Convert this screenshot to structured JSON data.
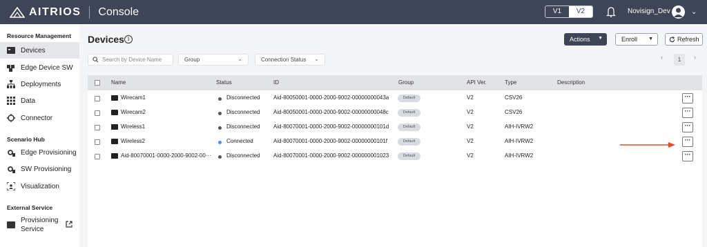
{
  "header": {
    "brand": "AITRIOS",
    "app": "Console",
    "versions": [
      "V1",
      "V2"
    ],
    "user": "Novisign_Dev"
  },
  "sidebar": {
    "sections": [
      {
        "title": "Resource Management",
        "items": [
          {
            "label": "Devices",
            "icon": "devices-icon"
          },
          {
            "label": "Edge Device SW",
            "icon": "puzzle-icon"
          },
          {
            "label": "Deployments",
            "icon": "hierarchy-icon"
          },
          {
            "label": "Data",
            "icon": "grid-icon"
          },
          {
            "label": "Connector",
            "icon": "connector-icon"
          }
        ]
      },
      {
        "title": "Scenario Hub",
        "items": [
          {
            "label": "Edge Provisioning",
            "icon": "gear-icon"
          },
          {
            "label": "SW Provisioning",
            "icon": "gear-icon"
          },
          {
            "label": "Visualization",
            "icon": "visualization-icon"
          }
        ]
      },
      {
        "title": "External Service",
        "items": [
          {
            "label": "Provisioning Service",
            "label_line1": "Provisioning",
            "label_line2": "Service",
            "icon": "service-icon"
          }
        ]
      }
    ]
  },
  "main": {
    "title": "Devices",
    "actions_label": "Actions",
    "enroll_label": "Enroll",
    "refresh_label": "Refresh",
    "search_placeholder": "Search by Device Name",
    "group_filter": "Group",
    "status_filter": "Connection Status",
    "page": "1"
  },
  "table": {
    "columns": [
      "Name",
      "Status",
      "ID",
      "Group",
      "API Ver.",
      "Type",
      "Description"
    ],
    "rows": [
      {
        "name": "Wirecam1",
        "status": "Disconnected",
        "id": "Aid-80050001-0000-2000-9002-00000000043a",
        "group": "Default",
        "api": "V2",
        "type": "CSV26",
        "description": ""
      },
      {
        "name": "Wirecam2",
        "status": "Disconnected",
        "id": "Aid-80050001-0000-2000-9002-00000000048c",
        "group": "Default",
        "api": "V2",
        "type": "CSV26",
        "description": ""
      },
      {
        "name": "Wireless1",
        "status": "Disconnected",
        "id": "Aid-80070001-0000-2000-9002-00000000101d",
        "group": "Default",
        "api": "V2",
        "type": "AIH-IVRW2",
        "description": ""
      },
      {
        "name": "Wireless2",
        "status": "Connected",
        "id": "Aid-80070001-0000-2000-9002-00000000101f",
        "group": "Default",
        "api": "V2",
        "type": "AIH-IVRW2",
        "description": ""
      },
      {
        "name": "Aid-80070001-0000-2000-9002-00···",
        "status": "Disconnected",
        "id": "Aid-80070001-0000-2000-9002-000000001023",
        "group": "Default",
        "api": "V2",
        "type": "AIH-IVRW2",
        "description": ""
      }
    ]
  },
  "colors": {
    "header_bg": "#3d4556",
    "connected": "#4a90e2",
    "disconnected": "#555555",
    "arrow": "#e8472f"
  }
}
